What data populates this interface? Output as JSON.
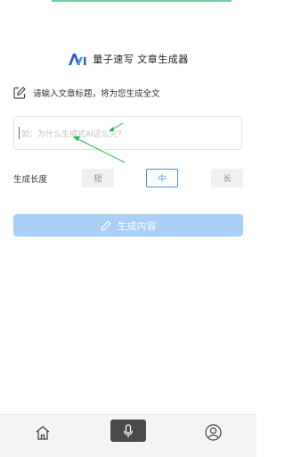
{
  "app": {
    "title": "量子速写 文章生成器"
  },
  "prompt": {
    "text": "请输入文章标题，将为您生成全文"
  },
  "title_input": {
    "value": "",
    "placeholder": "如：为什么生成式AI这么火?"
  },
  "length": {
    "label": "生成长度",
    "options": [
      "短",
      "中",
      "长"
    ],
    "selected": "中"
  },
  "generate_button": {
    "label": "生成内容"
  },
  "colors": {
    "accent": "#4a90e2",
    "button_disabled": "#a9cff6",
    "annotation_arrow": "#2db34a"
  },
  "nav": {
    "items": [
      "home-icon",
      "microphone-icon",
      "user-icon"
    ],
    "active": "microphone-icon"
  }
}
